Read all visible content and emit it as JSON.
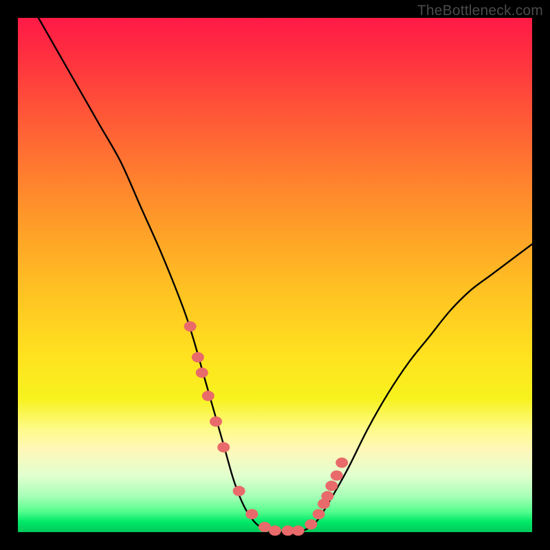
{
  "watermark": "TheBottleneck.com",
  "colors": {
    "frame": "#000000",
    "curve": "#000000",
    "marker_fill": "#e96a6a",
    "marker_stroke": "#c94e4e"
  },
  "chart_data": {
    "type": "line",
    "title": "",
    "xlabel": "",
    "ylabel": "",
    "xlim": [
      0,
      100
    ],
    "ylim": [
      0,
      100
    ],
    "grid": false,
    "series": [
      {
        "name": "bottleneck-curve",
        "x": [
          4,
          8,
          12,
          16,
          20,
          24,
          28,
          32,
          34,
          36,
          38,
          40,
          42,
          44,
          46,
          48,
          50,
          52,
          54,
          56,
          58,
          60,
          64,
          68,
          72,
          76,
          80,
          84,
          88,
          92,
          96,
          100
        ],
        "values": [
          100,
          93,
          86,
          79,
          72,
          63,
          54,
          44,
          38,
          31,
          24,
          17,
          10,
          5,
          2,
          0.5,
          0,
          0,
          0,
          0.5,
          2,
          5,
          12,
          20,
          27,
          33,
          38,
          43,
          47,
          50,
          53,
          56
        ]
      }
    ],
    "markers": {
      "name": "highlighted-points",
      "x": [
        33.5,
        35.0,
        35.8,
        37.0,
        38.5,
        40.0,
        43.0,
        45.5,
        48.0,
        50.0,
        52.5,
        54.5,
        57.0,
        58.5,
        59.5,
        60.2,
        61.0,
        62.0,
        63.0
      ],
      "values": [
        40.0,
        34.0,
        31.0,
        26.5,
        21.5,
        16.5,
        8.0,
        3.5,
        1.0,
        0.3,
        0.3,
        0.3,
        1.5,
        3.5,
        5.5,
        7.0,
        9.0,
        11.0,
        13.5
      ]
    }
  }
}
